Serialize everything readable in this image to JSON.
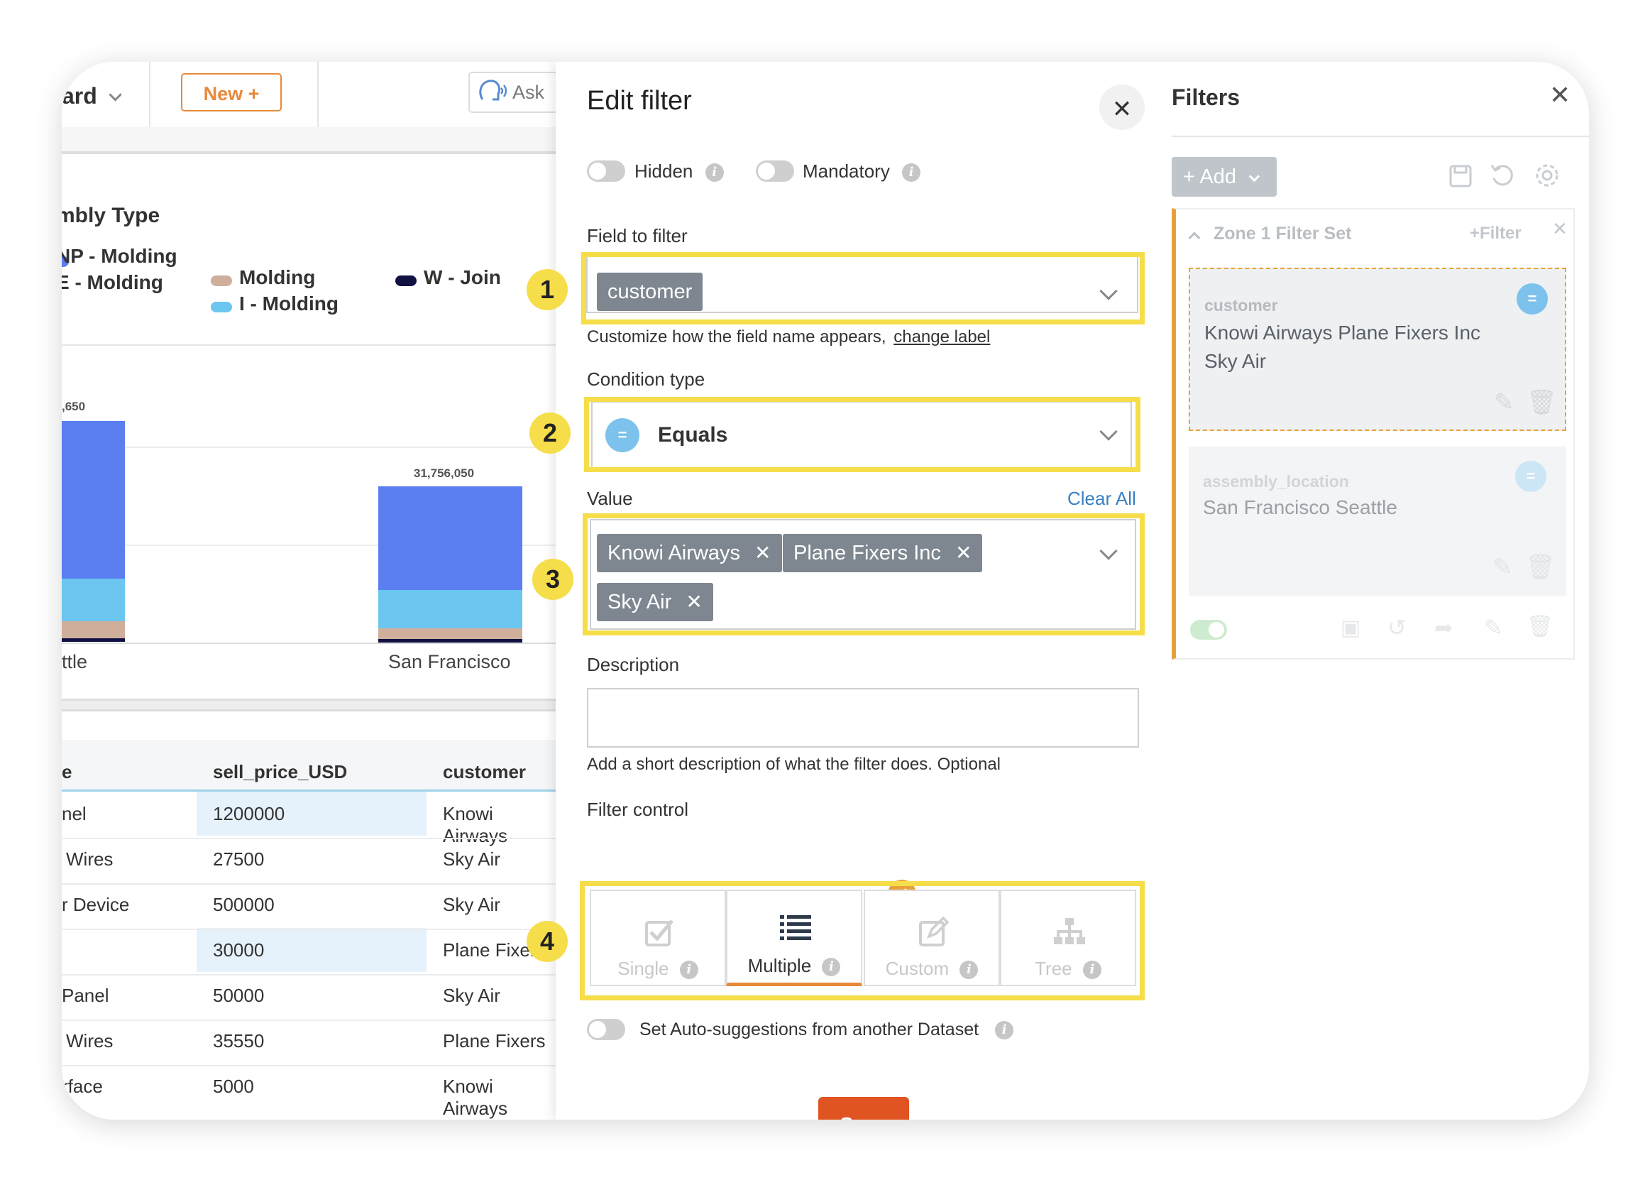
{
  "dashboard": {
    "title_partial": "ard",
    "new_button": "New +",
    "ask_label": "Ask",
    "chart": {
      "title_partial": "mbly Type",
      "legend": [
        {
          "label": "NP - Molding",
          "color": "#5b7ff0"
        },
        {
          "label": "E - Molding",
          "color": "#3a4fc0"
        },
        {
          "label": "Molding",
          "color": "#cfae9b"
        },
        {
          "label": "I - Molding",
          "color": "#6cc6ef"
        },
        {
          "label": "W - Join",
          "color": "#111144"
        }
      ],
      "partial_bar_label": ",650",
      "bar_label": "31,756,050",
      "x_labels": [
        "ttle",
        "San Francisco"
      ]
    },
    "table": {
      "headers": [
        "e",
        "sell_price_USD",
        "customer"
      ],
      "rows": [
        [
          "nel",
          "1200000",
          "Knowi Airways"
        ],
        [
          "Wires",
          "27500",
          "Sky Air"
        ],
        [
          "r Device",
          "500000",
          "Sky Air"
        ],
        [
          "",
          "30000",
          "Plane Fixers"
        ],
        [
          "Panel",
          "50000",
          "Sky Air"
        ],
        [
          "Wires",
          "35550",
          "Plane Fixers"
        ],
        [
          "rface",
          "5000",
          "Knowi Airways"
        ]
      ]
    }
  },
  "chart_data": {
    "type": "bar",
    "stacked": true,
    "title": "mbly Type",
    "categories": [
      "ttle",
      "San Francisco"
    ],
    "series": [
      {
        "name": "W - Join",
        "color": "#111144",
        "values": [
          null,
          null
        ]
      },
      {
        "name": "Molding",
        "color": "#cfae9b",
        "values": [
          null,
          null
        ]
      },
      {
        "name": "I - Molding",
        "color": "#6cc6ef",
        "values": [
          null,
          null
        ]
      },
      {
        "name": "NP - Molding",
        "color": "#5b7ff0",
        "values": [
          null,
          null
        ]
      }
    ],
    "totals": [
      null,
      31756050
    ],
    "data_labels": [
      ",650",
      "31,756,050"
    ]
  },
  "modal": {
    "title": "Edit filter",
    "hidden_label": "Hidden",
    "mandatory_label": "Mandatory",
    "field_label": "Field to filter",
    "field_value": "customer",
    "customize_text": "Customize how the field name appears,",
    "change_label_link": "change label",
    "condition_label": "Condition type",
    "condition_value": "Equals",
    "equals_symbol": "=",
    "value_label": "Value",
    "clear_all": "Clear All",
    "values": [
      "Knowi Airways",
      "Plane Fixers Inc",
      "Sky Air"
    ],
    "remove_symbol": "✕",
    "description_label": "Description",
    "description_value": "",
    "description_help": "Add a short description of what the filter does. Optional",
    "filter_control_label": "Filter control",
    "controls": [
      {
        "label": "Single",
        "icon": "checkbox-icon",
        "selected": false
      },
      {
        "label": "Multiple",
        "icon": "list-icon",
        "selected": true
      },
      {
        "label": "Custom",
        "icon": "edit-icon",
        "selected": false
      },
      {
        "label": "Tree",
        "icon": "hierarchy-icon",
        "selected": false
      }
    ],
    "autosuggest_label": "Set Auto-suggestions from another Dataset",
    "save": "Save",
    "annotations": [
      "1",
      "2",
      "3",
      "4"
    ],
    "info_glyph": "i",
    "close_glyph": "✕"
  },
  "filters_panel": {
    "title": "Filters",
    "add_button": "+ Add",
    "filter_set_title": "Zone 1 Filter Set",
    "add_filter": "+Filter",
    "cards": [
      {
        "field": "customer",
        "values": "Knowi Airways Plane Fixers Inc Sky Air",
        "symbol": "="
      },
      {
        "field": "assembly_location",
        "values": "San Francisco Seattle",
        "symbol": "="
      }
    ]
  },
  "colors": {
    "highlight": "#f6dd4a",
    "save": "#e05422",
    "accent": "#e8893a",
    "chip": "#7e8790"
  }
}
